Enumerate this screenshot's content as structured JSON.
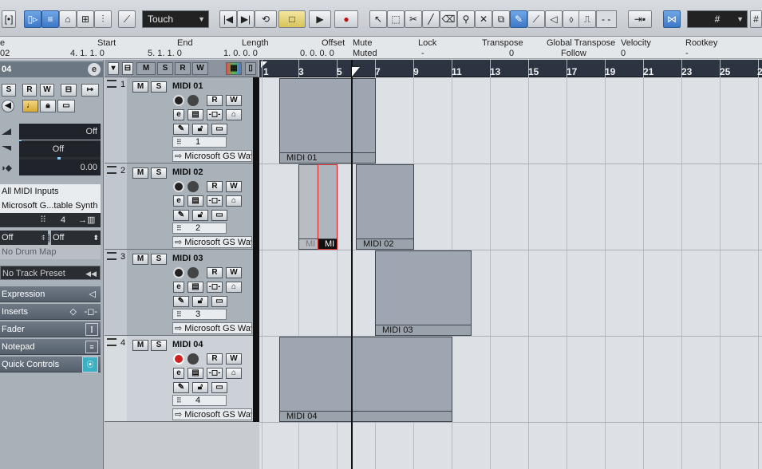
{
  "toolbar": {
    "automation_mode": "Touch",
    "grid_type": "#",
    "quantize_value": "- -"
  },
  "infoline": {
    "headers": {
      "name": "e",
      "start": "Start",
      "end": "End",
      "length": "Length",
      "offset": "Offset",
      "mute": "Mute",
      "lock": "Lock",
      "transpose": "Transpose",
      "global_transpose": "Global Transpose",
      "velocity": "Velocity",
      "rootkey": "Rootkey"
    },
    "values": {
      "name": "02",
      "start": "4. 1. 1.  0",
      "end": "5. 1. 1.  0",
      "length": "1. 0. 0.  0",
      "offset": "0. 0. 0.  0",
      "mute": "Muted",
      "lock": "-",
      "transpose": "0",
      "global_transpose": "Follow",
      "velocity": "0",
      "rootkey": "-"
    }
  },
  "inspector": {
    "title": "04",
    "volume": "Off",
    "pan": "Off",
    "delay": "0.00",
    "input_routing": "All MIDI Inputs",
    "output_routing": "Microsoft G...table Synth",
    "channel": "4",
    "bank": "Off",
    "program": "Off",
    "drum_map": "No Drum Map",
    "track_preset": "No Track Preset",
    "sections": [
      "Expression",
      "Inserts",
      "Fader",
      "Notepad",
      "Quick Controls"
    ]
  },
  "tracks": [
    {
      "number": "1",
      "name": "MIDI 01",
      "channel": "1",
      "output": "Microsoft GS Wavetable Synth"
    },
    {
      "number": "2",
      "name": "MIDI 02",
      "channel": "2",
      "output": "Microsoft GS Wavetable Synth"
    },
    {
      "number": "3",
      "name": "MIDI 03",
      "channel": "3",
      "output": "Microsoft GS Wavetable Synth"
    },
    {
      "number": "4",
      "name": "MIDI 04",
      "channel": "4",
      "output": "Microsoft GS Wavetable Synth"
    }
  ],
  "track_buttons": {
    "mute": "M",
    "solo": "S",
    "read": "R",
    "write": "W"
  },
  "ruler": {
    "labels": [
      "1",
      "3",
      "5",
      "7",
      "9",
      "11",
      "13",
      "15",
      "17",
      "19",
      "21",
      "23",
      "25",
      "2"
    ]
  },
  "parts": [
    {
      "label": "MIDI 01"
    },
    {
      "label": "MIDI 02"
    },
    {
      "label": "MIDI 03"
    },
    {
      "label": "MIDI 04"
    },
    {
      "label": "MI"
    },
    {
      "label": "MI"
    }
  ]
}
